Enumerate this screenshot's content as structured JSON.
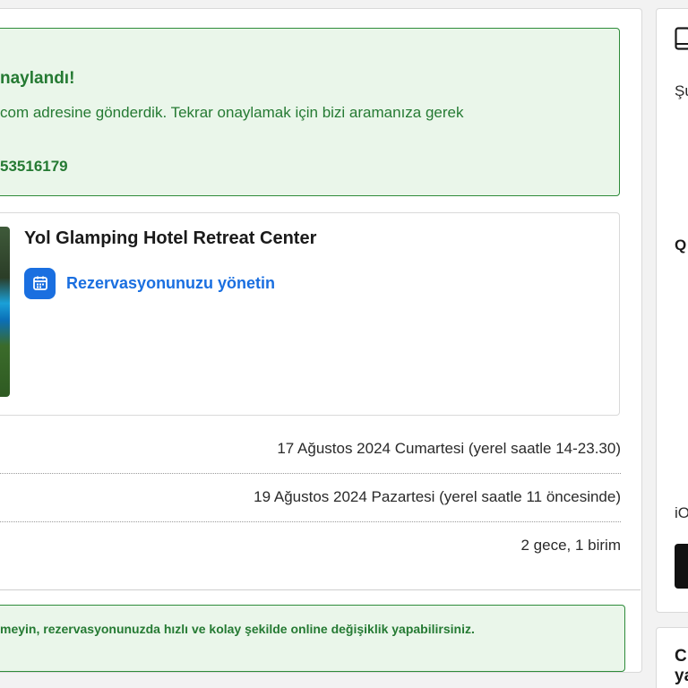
{
  "confirmation": {
    "title": "naylandı!",
    "text": "com adresine gönderdik. Tekrar onaylamak için bizi aramanıza gerek",
    "number": "53516179"
  },
  "hotel": {
    "name": "Yol Glamping Hotel Retreat Center",
    "manage_label": "Rezervasyonunuzu yönetin"
  },
  "details": {
    "checkin": "17 Ağustos 2024 Cumartesi (yerel saatle 14-23.30)",
    "checkout": "19 Ağustos 2024 Pazartesi (yerel saatle 11 öncesinde)",
    "stay": "2 gece, 1 birim"
  },
  "tip": {
    "text": "meyin, rezervasyonunuzda hızlı ve kolay şekilde online değişiklik yapabilirsiniz."
  },
  "side_panel": {
    "icon": "phone-icon",
    "text_a": "Şu",
    "text_b": "Q",
    "text_c": "iO",
    "text_d_line1": "C",
    "text_d_line2": "ya"
  },
  "colors": {
    "success_green": "#257a33",
    "success_bg": "#eaf6ea",
    "link_blue": "#1a6fe0"
  }
}
